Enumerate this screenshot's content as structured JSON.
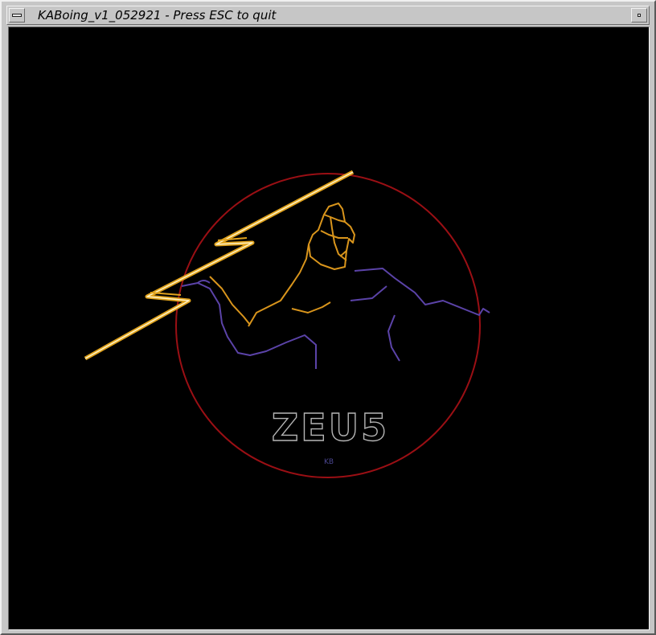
{
  "window": {
    "title": "KABoing_v1_052921 - Press ESC to quit"
  },
  "artwork": {
    "wordmark": "ZEU5",
    "signature": "KB",
    "colors": {
      "circle": "#9a0f14",
      "bolt": "#e0a21c",
      "bolt_core": "#fff4c8",
      "helmet": "#d9951c",
      "body": "#5b43a8",
      "wordmark": "#b4b4b4",
      "signature": "#4a4690"
    }
  }
}
